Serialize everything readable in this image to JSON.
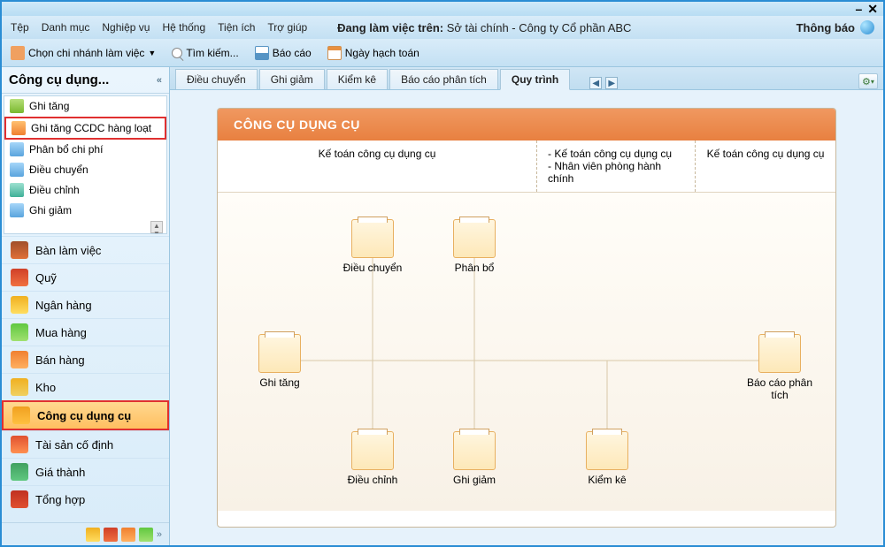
{
  "window": {
    "min": "–",
    "close": "✕"
  },
  "menu": [
    "Tệp",
    "Danh mục",
    "Nghiệp vụ",
    "Hệ thống",
    "Tiện ích",
    "Trợ giúp"
  ],
  "status": {
    "prefix": "Đang làm việc trên:",
    "value": "Sở tài chính - Công ty Cổ phần ABC"
  },
  "notification_label": "Thông báo",
  "toolbar": {
    "branch": "Chọn chi nhánh làm việc",
    "search": "Tìm kiếm...",
    "report": "Báo cáo",
    "date": "Ngày hạch toán"
  },
  "sidebar": {
    "title": "Công cụ dụng...",
    "items": [
      {
        "label": "Ghi tăng",
        "icon": "s-green"
      },
      {
        "label": "Ghi tăng CCDC hàng loạt",
        "icon": "s-orange",
        "hl": true
      },
      {
        "label": "Phân bổ chi phí",
        "icon": "s-blue"
      },
      {
        "label": "Điều chuyển",
        "icon": "s-blue"
      },
      {
        "label": "Điều chỉnh",
        "icon": "s-teal"
      },
      {
        "label": "Ghi giảm",
        "icon": "s-blue"
      }
    ]
  },
  "nav": [
    {
      "label": "Bàn làm việc",
      "icon": "n1"
    },
    {
      "label": "Quỹ",
      "icon": "n2"
    },
    {
      "label": "Ngân hàng",
      "icon": "n3"
    },
    {
      "label": "Mua hàng",
      "icon": "n4"
    },
    {
      "label": "Bán hàng",
      "icon": "n5"
    },
    {
      "label": "Kho",
      "icon": "n6"
    },
    {
      "label": "Công cụ dụng cụ",
      "icon": "n7",
      "sel": true
    },
    {
      "label": "Tài sản cố định",
      "icon": "n8"
    },
    {
      "label": "Giá thành",
      "icon": "n9"
    },
    {
      "label": "Tổng hợp",
      "icon": "n10"
    }
  ],
  "tabs": [
    "Điều chuyển",
    "Ghi giảm",
    "Kiểm kê",
    "Báo cáo phân tích",
    "Quy trình"
  ],
  "active_tab": 4,
  "panel": {
    "title": "CÔNG CỤ DỤNG CỤ",
    "col1": "Kế toán công cụ dụng cụ",
    "col2a": "- Kế toán công cụ dụng cụ",
    "col2b": "- Nhân viên phòng hành chính",
    "col3": "Kế toán công cụ dụng cụ"
  },
  "nodes": {
    "ghitang": "Ghi tăng",
    "dieuchuyen": "Điều chuyển",
    "phanbo": "Phân bổ",
    "dieuchinh": "Điều chỉnh",
    "ghigiam": "Ghi giảm",
    "kiemke": "Kiểm kê",
    "baocao": "Báo cáo phân tích"
  }
}
